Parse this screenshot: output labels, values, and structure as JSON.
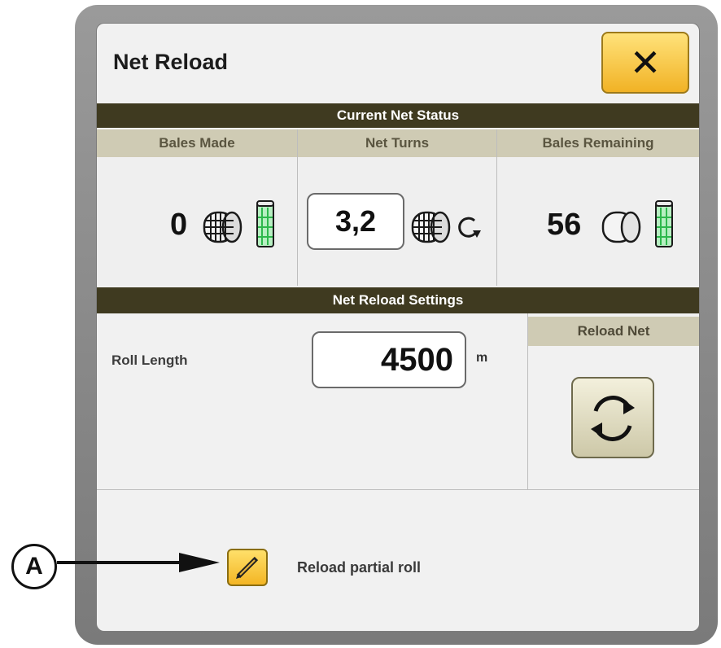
{
  "dialog": {
    "title": "Net Reload",
    "close_label": "✕"
  },
  "status": {
    "header": "Current Net Status",
    "columns": [
      {
        "label": "Bales Made",
        "value": "0"
      },
      {
        "label": "Net Turns",
        "value": "3,2"
      },
      {
        "label": "Bales Remaining",
        "value": "56"
      }
    ]
  },
  "settings": {
    "header": "Net Reload Settings",
    "roll_length_label": "Roll Length",
    "roll_length_value": "4500",
    "roll_length_unit": "m",
    "reload_net_label": "Reload Net"
  },
  "partial": {
    "label": "Reload partial roll"
  },
  "callout": {
    "letter": "A"
  },
  "colors": {
    "header_bar": "#3f3a20",
    "column_header": "#cfcbb4",
    "accent_yellow": "#f1b225",
    "net_green": "#3bd15a"
  }
}
